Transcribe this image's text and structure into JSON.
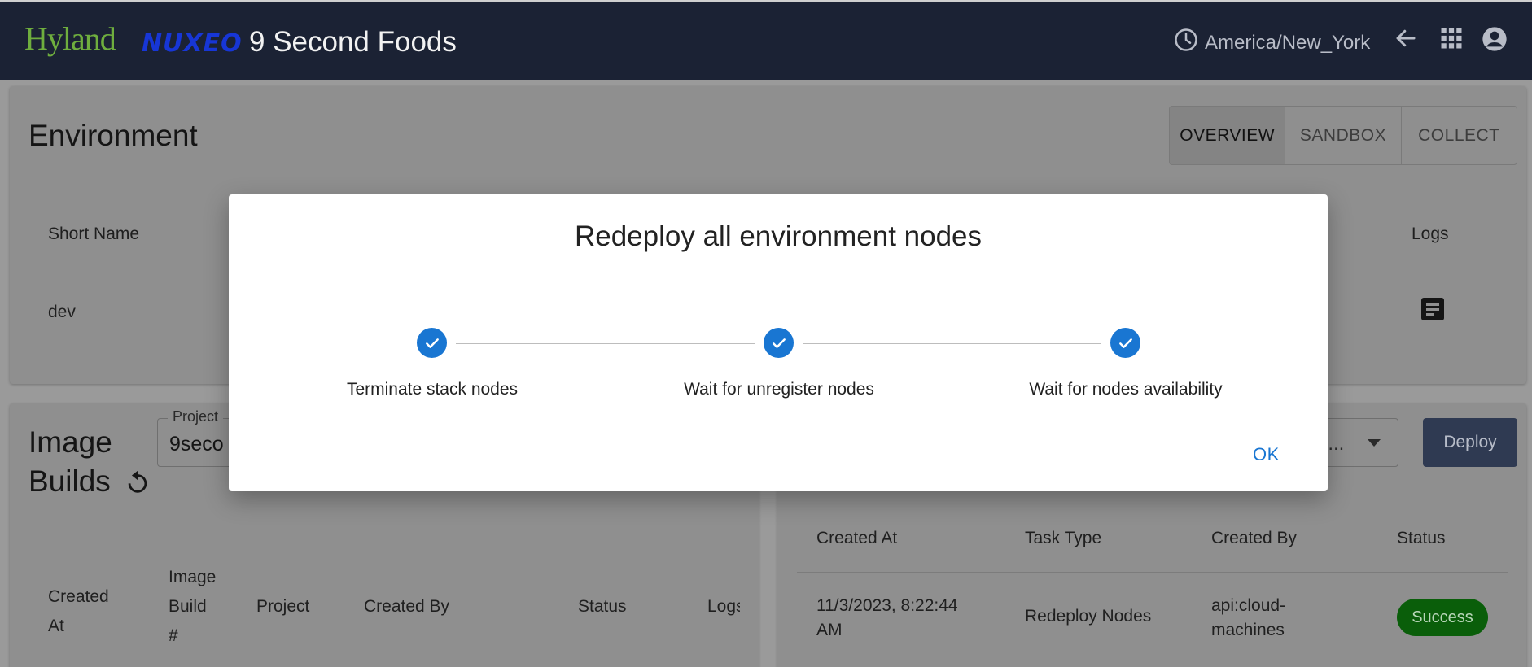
{
  "header": {
    "logo_hyland": "Hyland",
    "logo_nuxeo": "NUXEO",
    "app_title": "9 Second Foods",
    "timezone": "America/New_York"
  },
  "environment": {
    "title": "Environment",
    "tabs": [
      {
        "label": "OVERVIEW",
        "active": true
      },
      {
        "label": "SANDBOX",
        "active": false
      },
      {
        "label": "COLLECT",
        "active": false
      }
    ],
    "columns": {
      "short_name": "Short Name",
      "logs": "Logs"
    },
    "row": {
      "short_name": "dev"
    }
  },
  "image_builds": {
    "title_line1": "Image",
    "title_line2": "Builds",
    "project_label": "Project",
    "project_value": "9seco",
    "columns": {
      "created_at": [
        "Created",
        "At"
      ],
      "image_build": [
        "Image",
        "Build",
        "#"
      ],
      "project": "Project",
      "created_by": "Created By",
      "status": "Status",
      "logs": "Logs"
    }
  },
  "tasks": {
    "select_value": "e...",
    "deploy_label": "Deploy",
    "columns": {
      "created_at": "Created At",
      "task_type": "Task Type",
      "created_by": "Created By",
      "status": "Status"
    },
    "row": {
      "created_at_line1": "11/3/2023, 8:22:44",
      "created_at_line2": "AM",
      "task_type": "Redeploy Nodes",
      "created_by_line1": "api:cloud-",
      "created_by_line2": "machines",
      "status": "Success"
    }
  },
  "modal": {
    "title": "Redeploy all environment nodes",
    "steps": [
      {
        "label": "Terminate stack nodes",
        "completed": true
      },
      {
        "label": "Wait for unregister nodes",
        "completed": true
      },
      {
        "label": "Wait for nodes availability",
        "completed": true
      }
    ],
    "ok_label": "OK",
    "accent_color": "#1976d2"
  }
}
